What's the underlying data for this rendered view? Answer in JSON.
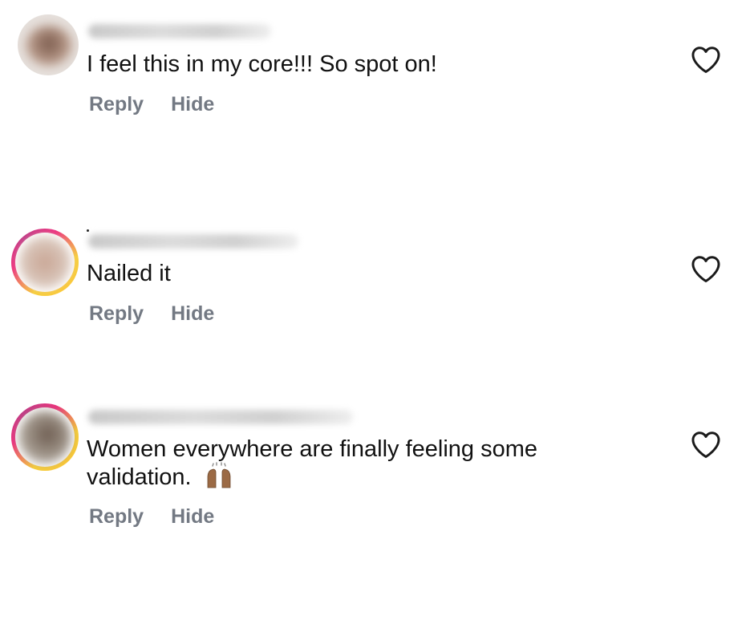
{
  "comments": [
    {
      "text": "I feel this in my core!!! So spot on!",
      "reply_label": "Reply",
      "hide_label": "Hide",
      "avatar_ring": false,
      "avatar_colors": [
        "#b89a8a",
        "#7a5a4c"
      ]
    },
    {
      "text": "Nailed it",
      "reply_label": "Reply",
      "hide_label": "Hide",
      "avatar_ring": true,
      "avatar_colors": [
        "#d8c4b8",
        "#c9a594"
      ]
    },
    {
      "text": "Women everywhere are finally feeling some validation. ",
      "emoji": "raising-hands-emoji",
      "reply_label": "Reply",
      "hide_label": "Hide",
      "avatar_ring": true,
      "avatar_colors": [
        "#a49a8f",
        "#6d5c50"
      ]
    }
  ],
  "colors": {
    "action_gray": "#737983",
    "text": "#111111",
    "heart_stroke": "#1a1a1a"
  }
}
